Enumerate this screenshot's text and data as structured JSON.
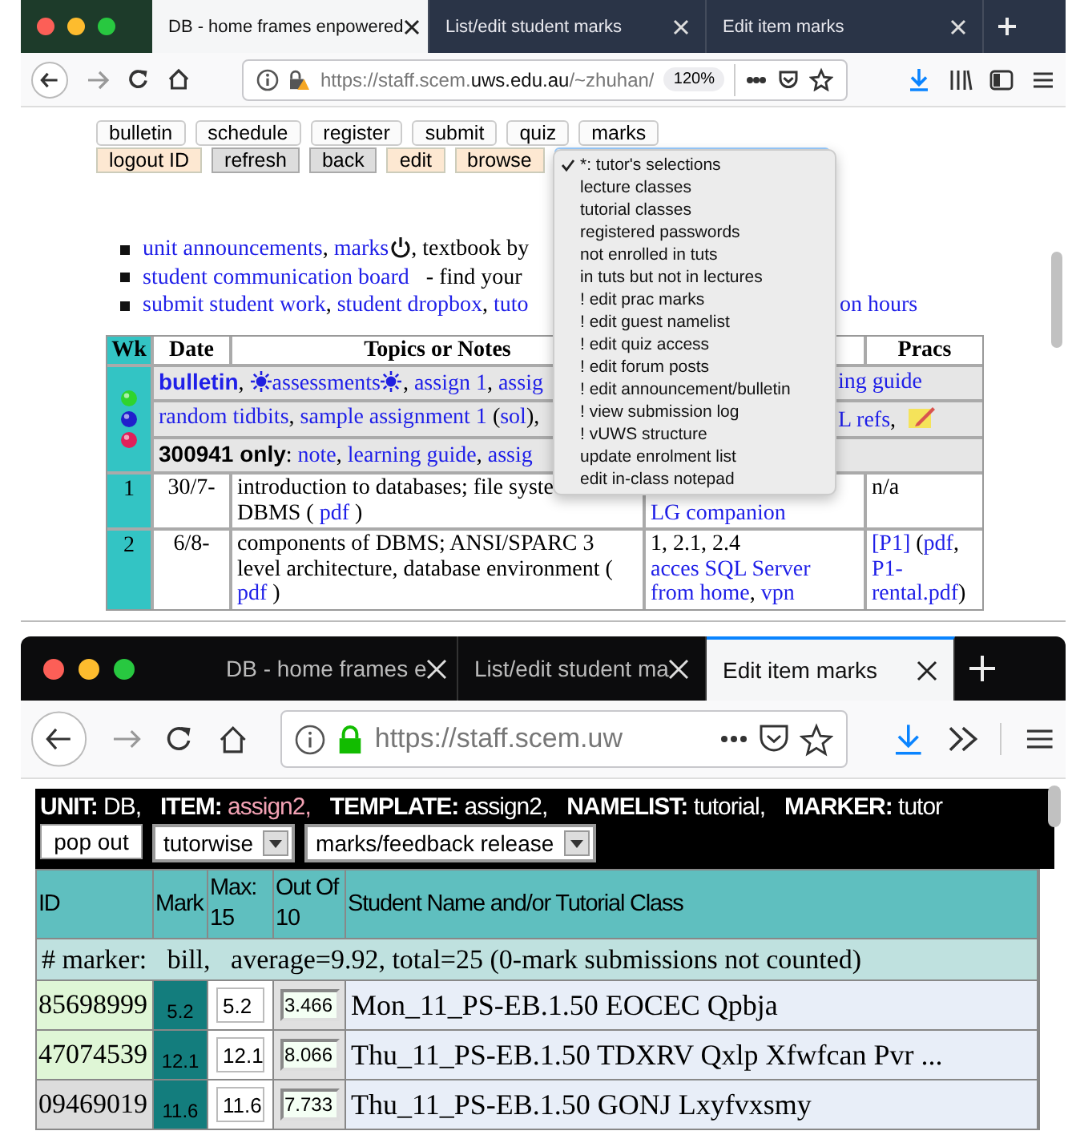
{
  "top_window": {
    "tabs": [
      {
        "label": "DB - home frames enpowered",
        "selected": true
      },
      {
        "label": "List/edit student marks",
        "selected": false
      },
      {
        "label": "Edit item marks",
        "selected": false
      }
    ],
    "url": [
      {
        "text": "https://staff.scem.",
        "host": false
      },
      {
        "text": "uws.edu.au",
        "host": true
      },
      {
        "text": "/~zhuhan/",
        "host": false
      }
    ],
    "zoom": "120%",
    "nav_rows": [
      [
        {
          "label": "bulletin",
          "kind": "plain"
        },
        {
          "label": "schedule",
          "kind": "plain"
        },
        {
          "label": "register",
          "kind": "plain"
        },
        {
          "label": "submit",
          "kind": "plain"
        },
        {
          "label": "quiz",
          "kind": "plain"
        },
        {
          "label": "marks",
          "kind": "plain"
        }
      ],
      [
        {
          "label": "logout ID",
          "kind": "accent"
        },
        {
          "label": "refresh",
          "kind": "grey"
        },
        {
          "label": "back",
          "kind": "grey"
        },
        {
          "label": "edit",
          "kind": "accent"
        },
        {
          "label": "browse",
          "kind": "accent"
        }
      ]
    ],
    "menu": {
      "items": [
        {
          "label": "*: tutor's selections",
          "checked": true
        },
        {
          "label": "lecture classes",
          "checked": false
        },
        {
          "label": "tutorial classes",
          "checked": false
        },
        {
          "label": "registered passwords",
          "checked": false
        },
        {
          "label": "not enrolled in tuts",
          "checked": false
        },
        {
          "label": "in tuts but not in lectures",
          "checked": false
        },
        {
          "label": "! edit prac marks",
          "checked": false
        },
        {
          "label": "! edit guest namelist",
          "checked": false
        },
        {
          "label": "! edit quiz access",
          "checked": false
        },
        {
          "label": "! edit forum posts",
          "checked": false
        },
        {
          "label": "! edit announcement/bulletin",
          "checked": false
        },
        {
          "label": "! view submission log",
          "checked": false
        },
        {
          "label": "! vUWS structure",
          "checked": false
        },
        {
          "label": "update enrolment list",
          "checked": false
        },
        {
          "label": "edit in-class notepad",
          "checked": false
        }
      ]
    },
    "bullets": [
      {
        "left": [
          {
            "kind": "link",
            "text": "unit announcements"
          },
          {
            "kind": "plain",
            "text": ", "
          },
          {
            "kind": "link",
            "text": "marks"
          },
          {
            "kind": "power_icon"
          },
          {
            "kind": "plain",
            "text": ", textbook by"
          }
        ]
      },
      {
        "left": [
          {
            "kind": "link",
            "text": "student communication board"
          },
          {
            "kind": "plain",
            "text": "   - find your"
          }
        ]
      },
      {
        "left": [
          {
            "kind": "link",
            "text": "submit student work"
          },
          {
            "kind": "plain",
            "text": ", "
          },
          {
            "kind": "link",
            "text": "student dropbox"
          },
          {
            "kind": "plain",
            "text": ", "
          },
          {
            "kind": "link",
            "text": "tuto"
          }
        ],
        "right": [
          {
            "kind": "link",
            "text": "on hours"
          }
        ]
      }
    ],
    "table": {
      "columns": [
        {
          "heading": "Wk"
        },
        {
          "heading": "Date"
        },
        {
          "heading": "Topics or Notes"
        },
        {},
        {
          "heading": "Pracs"
        }
      ],
      "banner_rows": [
        {
          "left": [
            {
              "kind": "bold_link",
              "text": "bulletin"
            },
            {
              "kind": "plain",
              "text": ", "
            },
            {
              "kind": "sun_icon"
            },
            {
              "kind": "link",
              "text": "assessments"
            },
            {
              "kind": "sun_icon"
            },
            {
              "kind": "plain",
              "text": ", "
            },
            {
              "kind": "link",
              "text": "assign 1"
            },
            {
              "kind": "plain",
              "text": ", "
            },
            {
              "kind": "link",
              "text": "assig"
            }
          ],
          "right": [
            {
              "kind": "link",
              "text": "ing guide"
            }
          ]
        },
        {
          "left": [
            {
              "kind": "link",
              "text": "random tidbits"
            },
            {
              "kind": "plain",
              "text": ", "
            },
            {
              "kind": "link",
              "text": "sample assignment 1"
            },
            {
              "kind": "plain",
              "text": " ("
            },
            {
              "kind": "link",
              "text": "sol"
            },
            {
              "kind": "plain",
              "text": "),"
            }
          ],
          "right": [
            {
              "kind": "link",
              "text": "L refs"
            },
            {
              "kind": "plain",
              "text": ",  "
            },
            {
              "kind": "note_icon"
            }
          ]
        },
        {
          "left": [
            {
              "kind": "bold",
              "text": "300941 only"
            },
            {
              "kind": "plain",
              "text": ": "
            },
            {
              "kind": "link",
              "text": "note"
            },
            {
              "kind": "plain",
              "text": ", "
            },
            {
              "kind": "link",
              "text": "learning guide"
            },
            {
              "kind": "plain",
              "text": ", "
            },
            {
              "kind": "link",
              "text": "assig"
            }
          ]
        }
      ],
      "weeks": [
        {
          "wk": "1",
          "date": "30/7-",
          "topics": [
            [
              {
                "kind": "plain",
                "text": "introduction to databases; file syste"
              }
            ],
            [
              {
                "kind": "plain",
                "text": "DBMS ( "
              },
              {
                "kind": "link",
                "text": "pdf"
              },
              {
                "kind": "plain",
                "text": " )"
              }
            ]
          ],
          "column_4": [
            [
              {
                "kind": "link",
                "text": "LG companion"
              }
            ]
          ],
          "pracs": [
            [
              {
                "kind": "plain",
                "text": "n/a"
              }
            ]
          ]
        },
        {
          "wk": "2",
          "date": "6/8-",
          "topics": [
            [
              {
                "kind": "plain",
                "text": "components of DBMS; ANSI/SPARC 3"
              }
            ],
            [
              {
                "kind": "plain",
                "text": "level architecture, database environment ("
              }
            ],
            [
              {
                "kind": "link",
                "text": "pdf"
              },
              {
                "kind": "plain",
                "text": " )"
              }
            ]
          ],
          "column_4": [
            [
              {
                "kind": "plain",
                "text": "1, 2.1, 2.4"
              }
            ],
            [
              {
                "kind": "link",
                "text": "acces SQL Server"
              }
            ],
            [
              {
                "kind": "link",
                "text": "from home"
              },
              {
                "kind": "plain",
                "text": ", "
              },
              {
                "kind": "link",
                "text": "vpn"
              }
            ]
          ],
          "pracs": [
            [
              {
                "kind": "link",
                "text": "[P1]"
              },
              {
                "kind": "plain",
                "text": " ("
              },
              {
                "kind": "link",
                "text": "pdf"
              },
              {
                "kind": "plain",
                "text": ","
              }
            ],
            [
              {
                "kind": "link",
                "text": "P1-"
              }
            ],
            [
              {
                "kind": "link",
                "text": "rental.pdf"
              },
              {
                "kind": "plain",
                "text": ")"
              }
            ]
          ]
        }
      ]
    }
  },
  "bottom_window": {
    "tabs": [
      {
        "label": "DB - home frames e",
        "selected": false
      },
      {
        "label": "List/edit student ma",
        "selected": false
      },
      {
        "label": "Edit item marks",
        "selected": true
      }
    ],
    "url": "https://staff.scem.uw",
    "header_fields": [
      {
        "label": "UNIT:",
        "value": "DB,",
        "emphasis": false
      },
      {
        "label": "ITEM:",
        "value": "assign2,",
        "emphasis": true
      },
      {
        "label": "TEMPLATE:",
        "value": "assign2,",
        "emphasis": false
      },
      {
        "label": "NAMELIST:",
        "value": "tutorial,",
        "emphasis": false
      },
      {
        "label": "MARKER:",
        "value": "tutor",
        "emphasis": false
      }
    ],
    "controls": [
      {
        "kind": "button",
        "label": "pop out"
      },
      {
        "kind": "select",
        "value": "tutorwise"
      },
      {
        "kind": "select",
        "value": "marks/feedback release"
      }
    ],
    "columns": [
      "ID",
      "Mark",
      "Max: 15",
      "Out Of 10",
      "Student Name and/or Tutorial Class"
    ],
    "summary": "# marker:   bill,   average=9.92, total=25 (0-mark submissions not counted)",
    "rows": [
      {
        "id": "85698999",
        "color": "#dff6d6",
        "mark": "5.2",
        "max": "5.2",
        "out_of": "3.466",
        "name": "Mon_11_PS-EB.1.50 EOCEC Qpbja"
      },
      {
        "id": "47074539",
        "color": "#dff6d6",
        "mark": "12.1",
        "max": "12.1",
        "out_of": "8.066",
        "name": "Thu_11_PS-EB.1.50 TDXRV Qxlp Xfwfcan Pvr ..."
      },
      {
        "id": "09469019",
        "color": "#dcdcdc",
        "mark": "11.6",
        "max": "11.6",
        "out_of": "7.733",
        "name": "Thu_11_PS-EB.1.50 GONJ Lxyfvxsmy"
      }
    ]
  }
}
